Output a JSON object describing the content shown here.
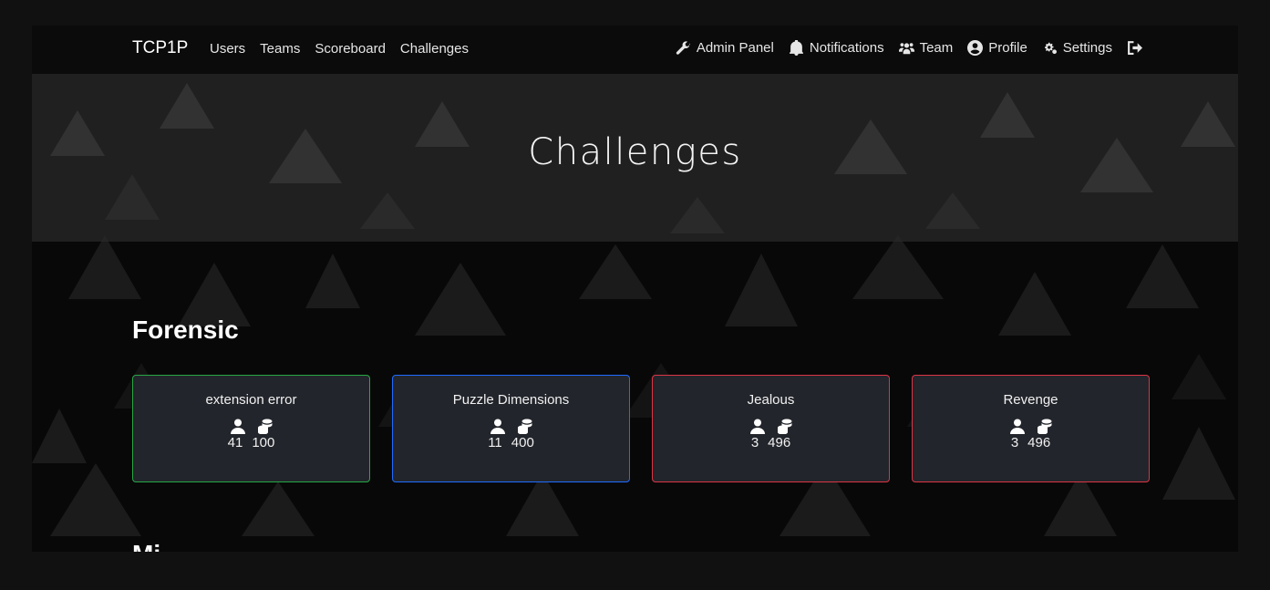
{
  "navbar": {
    "brand": "TCP1P",
    "left_links": [
      "Users",
      "Teams",
      "Scoreboard",
      "Challenges"
    ],
    "right_links": [
      {
        "label": "Admin Panel",
        "icon": "wrench-icon"
      },
      {
        "label": "Notifications",
        "icon": "bell-icon"
      },
      {
        "label": "Team",
        "icon": "users-icon"
      },
      {
        "label": "Profile",
        "icon": "user-circle-icon"
      },
      {
        "label": "Settings",
        "icon": "cogs-icon"
      }
    ],
    "logout_icon": "logout-icon"
  },
  "hero": {
    "title": "Challenges"
  },
  "category": {
    "name": "Forensic",
    "challenges": [
      {
        "name": "extension error",
        "solves": "41",
        "points": "100",
        "border": "#28a745"
      },
      {
        "name": "Puzzle Dimensions",
        "solves": "11",
        "points": "400",
        "border": "#1f6bff"
      },
      {
        "name": "Jealous",
        "solves": "3",
        "points": "496",
        "border": "#dc3545"
      },
      {
        "name": "Revenge",
        "solves": "3",
        "points": "496",
        "border": "#dc3545"
      }
    ]
  },
  "next_category": {
    "name": "Mi"
  }
}
